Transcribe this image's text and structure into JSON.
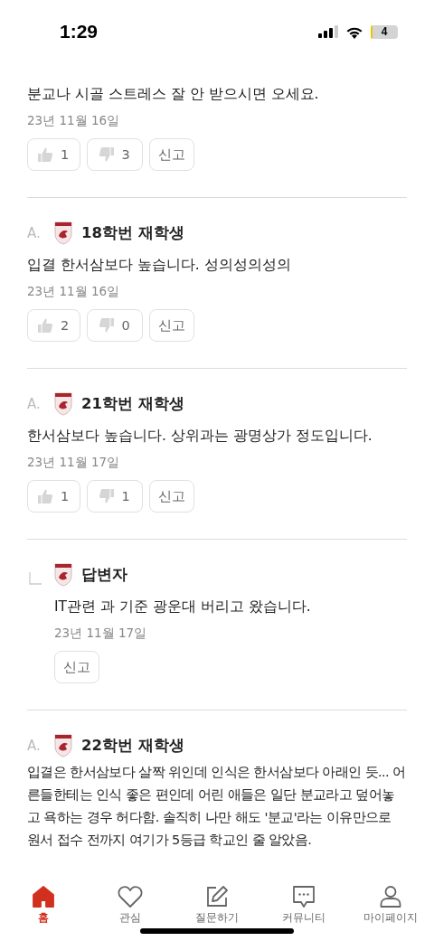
{
  "status_bar": {
    "time": "1:29",
    "battery": "4"
  },
  "answers": [
    {
      "kind": "tail",
      "body": "분교나 시골 스트레스 잘 안 받으시면 오세요.",
      "date": "23년 11월 16일",
      "likes": "1",
      "dislikes": "3",
      "report": "신고"
    },
    {
      "kind": "answer",
      "prefix": "A.",
      "author": "18학번 재학생",
      "body": "입결 한서삼보다 높습니다. 성의성의성의",
      "date": "23년 11월 16일",
      "likes": "2",
      "dislikes": "0",
      "report": "신고"
    },
    {
      "kind": "answer",
      "prefix": "A.",
      "author": "21학번 재학생",
      "body": "한서삼보다 높습니다. 상위과는 광명상가 정도입니다.",
      "date": "23년 11월 17일",
      "likes": "1",
      "dislikes": "1",
      "report": "신고"
    },
    {
      "kind": "reply",
      "author": "답변자",
      "body": "IT관련 과 기준 광운대 버리고 왔습니다.",
      "date": "23년 11월 17일",
      "report": "신고"
    },
    {
      "kind": "answer",
      "prefix": "A.",
      "author": "22학번 재학생",
      "body": "입결은 한서삼보다 살짝 위인데 인식은 한서삼보다 아래인 듯... 어른들한테는 인식 좋은 편인데 어린 애들은 일단 분교라고 덮어놓고 욕하는 경우 허다함. 솔직히 나만 해도 '분교'라는 이유만으로 원서 접수 전까지 여기가 5등급 학교인 줄 알았음."
    }
  ],
  "nav": [
    {
      "kind": "home",
      "label": "홈",
      "selected": true
    },
    {
      "kind": "heart",
      "label": "관심",
      "selected": false
    },
    {
      "kind": "write",
      "label": "질문하기",
      "selected": false
    },
    {
      "kind": "chat",
      "label": "커뮤니티",
      "selected": false
    },
    {
      "kind": "person",
      "label": "마이페이지",
      "selected": false
    }
  ]
}
